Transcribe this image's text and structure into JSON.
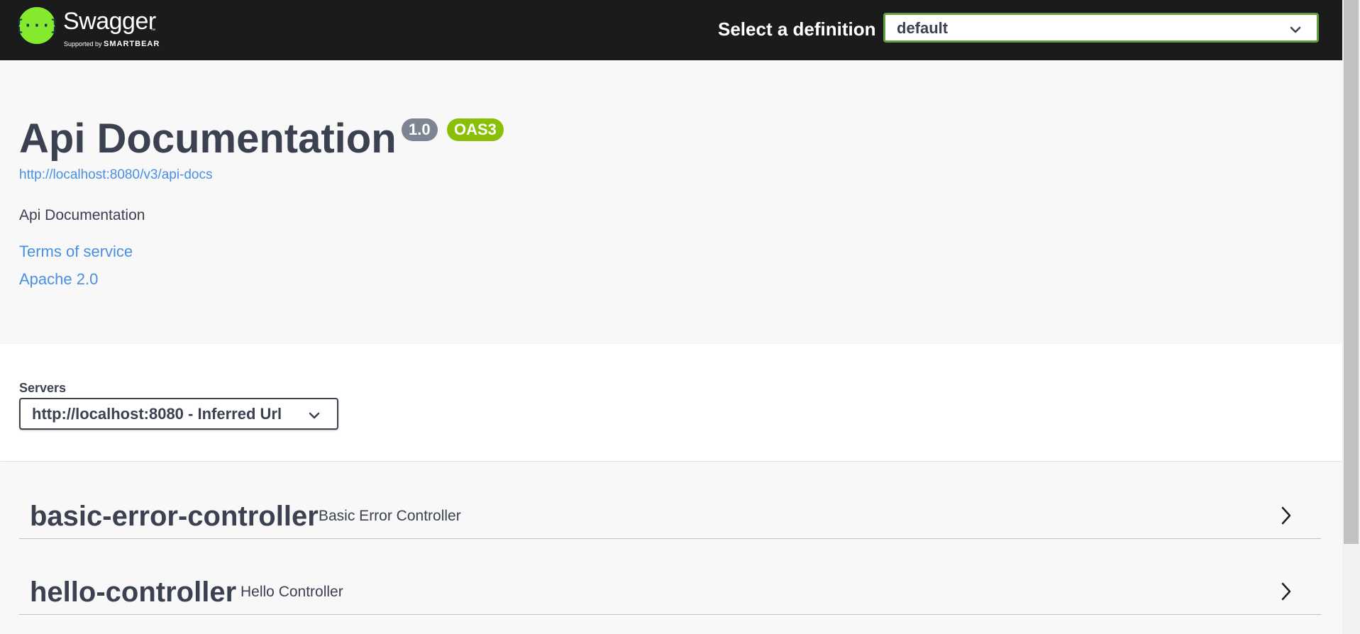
{
  "header": {
    "logo_name": "Swagger",
    "logo_tm": "™",
    "logo_sub_prefix": "Supported by ",
    "logo_sub_brand": "SMARTBEAR",
    "select_label": "Select a definition",
    "definition_value": "default",
    "logo_icon": "swagger-braces-icon",
    "brand_color": "#85ea2d",
    "bar_color": "#1b1b1b"
  },
  "info": {
    "title": "Api Documentation",
    "version_badge": "1.0",
    "oas_badge": "OAS3",
    "spec_url": "http://localhost:8080/v3/api-docs",
    "description": "Api Documentation",
    "terms_link": "Terms of service",
    "license_link": "Apache 2.0",
    "link_color": "#4990e2",
    "version_badge_color": "#7d8492",
    "oas_badge_color": "#89bf04"
  },
  "servers": {
    "label": "Servers",
    "selected": "http://localhost:8080 - Inferred Url"
  },
  "tags": [
    {
      "name": "basic-error-controller",
      "description": "Basic Error Controller",
      "icon": "chevron-right-icon"
    },
    {
      "name": "hello-controller",
      "description": "Hello Controller",
      "icon": "chevron-right-icon"
    }
  ]
}
